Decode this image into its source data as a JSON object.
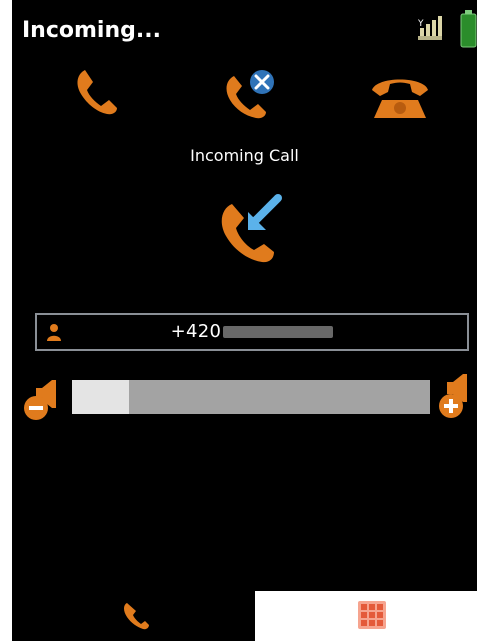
{
  "header": {
    "title": "Incoming..."
  },
  "actions": {
    "answer": "phone-icon",
    "reject": "phone-cancel-icon",
    "hangup": "hang-up-phone-icon"
  },
  "call": {
    "label": "Incoming Call",
    "direction_icon": "incoming-call-icon"
  },
  "caller": {
    "number": "+420",
    "icon": "person-icon"
  },
  "volume": {
    "level_fraction": 0.16
  },
  "bottom_tabs": [
    {
      "icon": "phone-icon"
    },
    {
      "icon": "keypad-icon"
    }
  ],
  "colors": {
    "background": "#000000",
    "accent": "#e07b1d",
    "border": "#8a8f96"
  }
}
